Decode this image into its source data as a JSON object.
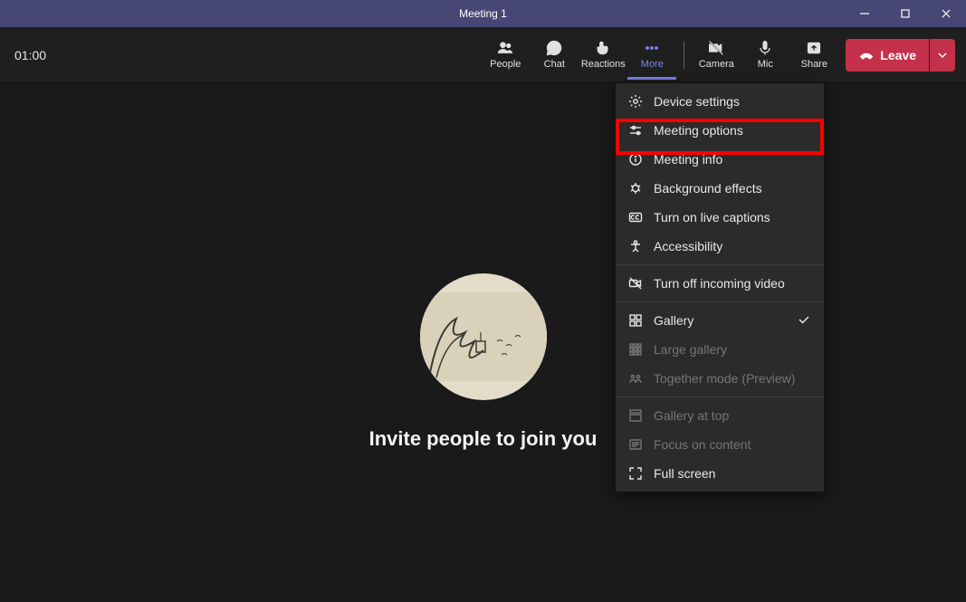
{
  "title": "Meeting 1",
  "timer": "01:00",
  "toolbar": {
    "people": "People",
    "chat": "Chat",
    "reactions": "Reactions",
    "more": "More",
    "camera": "Camera",
    "mic": "Mic",
    "share": "Share",
    "leave": "Leave"
  },
  "invite_text": "Invite people to join you",
  "menu": {
    "device_settings": "Device settings",
    "meeting_options": "Meeting options",
    "meeting_info": "Meeting info",
    "background_effects": "Background effects",
    "live_captions": "Turn on live captions",
    "accessibility": "Accessibility",
    "turn_off_incoming": "Turn off incoming video",
    "gallery": "Gallery",
    "large_gallery": "Large gallery",
    "together_mode": "Together mode (Preview)",
    "gallery_at_top": "Gallery at top",
    "focus_on_content": "Focus on content",
    "full_screen": "Full screen"
  }
}
